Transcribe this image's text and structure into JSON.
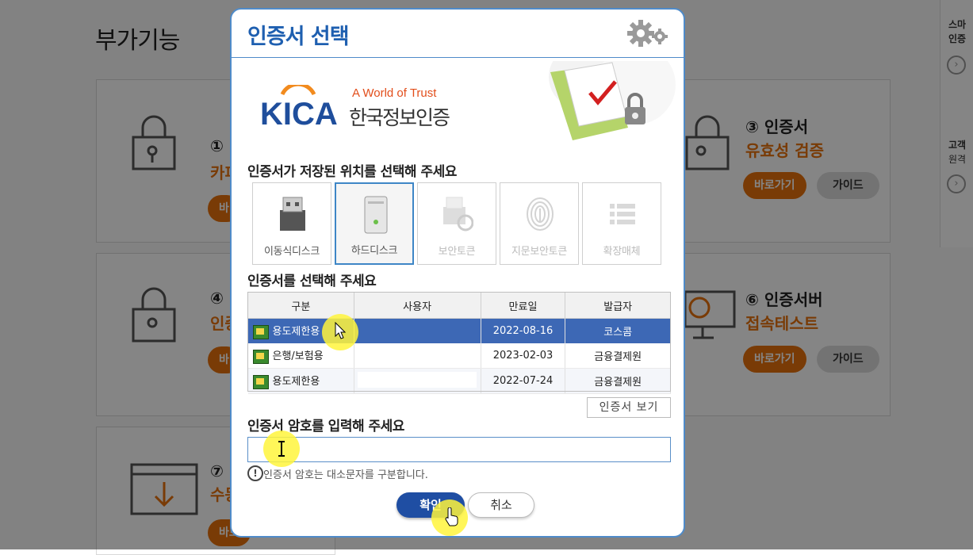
{
  "background": {
    "page_title": "부가기능",
    "cards": [
      {
        "num": "①",
        "sub": "카피",
        "go": "바"
      },
      {
        "num": "③ 인증서",
        "sub": "유효성 검증",
        "go": "바로가기",
        "guide": "가이드"
      },
      {
        "num": "④",
        "sub": "인증",
        "go": "바"
      },
      {
        "num": "⑥ 인증서버",
        "sub": "접속테스트",
        "go": "바로가기",
        "guide": "가이드"
      },
      {
        "num": "⑦",
        "sub": "수동",
        "go": "바로"
      }
    ],
    "side_panel": [
      {
        "line1": "스마",
        "line2": "인증"
      },
      {
        "line1": "고객",
        "line2": "원격"
      }
    ]
  },
  "dialog": {
    "title": "인증서 선택",
    "brand_tagline": "A World of Trust",
    "brand_name": "한국정보인증",
    "location_prompt": "인증서가 저장된 위치를 선택해 주세요",
    "locations": [
      {
        "label": "이동식디스크",
        "state": "enabled"
      },
      {
        "label": "하드디스크",
        "state": "selected"
      },
      {
        "label": "보안토큰",
        "state": "disabled"
      },
      {
        "label": "지문보안토큰",
        "state": "disabled"
      },
      {
        "label": "확장매체",
        "state": "disabled"
      }
    ],
    "cert_prompt": "인증서를 선택해 주세요",
    "table": {
      "headers": [
        "구분",
        "사용자",
        "만료일",
        "발급자"
      ],
      "rows": [
        {
          "type": "용도제한용",
          "user": "",
          "expiry": "2022-08-16",
          "issuer": "코스콤"
        },
        {
          "type": "은행/보험용",
          "user": "",
          "expiry": "2023-02-03",
          "issuer": "금융결제원"
        },
        {
          "type": "용도제한용",
          "user": "",
          "expiry": "2022-07-24",
          "issuer": "금융결제원"
        }
      ]
    },
    "view_cert_button": "인증서 보기",
    "password_prompt": "인증서 암호를 입력해 주세요",
    "password_value": "",
    "hint": "인증서 암호는 대소문자를 구분합니다.",
    "ok_button": "확인",
    "cancel_button": "취소"
  },
  "colors": {
    "accent_blue": "#1e5fb0",
    "selected_row": "#3d68b5",
    "orange": "#e8720c"
  }
}
